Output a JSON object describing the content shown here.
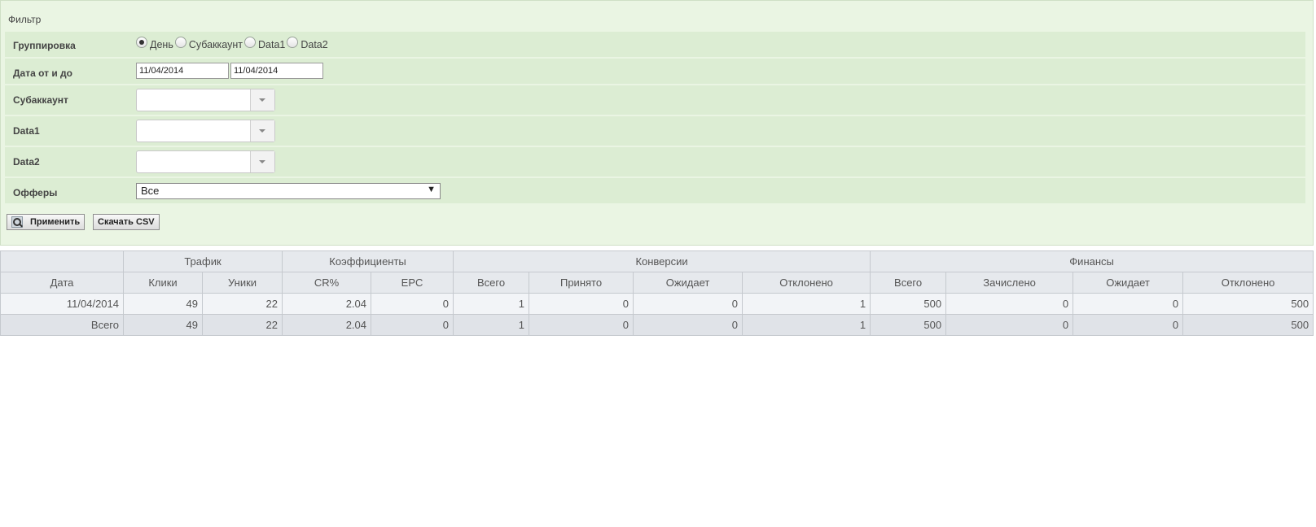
{
  "filter": {
    "legend": "Фильтр",
    "grouping": {
      "label": "Группировка",
      "options": [
        {
          "label": "День",
          "checked": true
        },
        {
          "label": "Субаккаунт",
          "checked": false
        },
        {
          "label": "Data1",
          "checked": false
        },
        {
          "label": "Data2",
          "checked": false
        }
      ]
    },
    "date_range": {
      "label": "Дата от и до",
      "from": "11/04/2014",
      "to": "11/04/2014"
    },
    "subaccount": {
      "label": "Субаккаунт",
      "value": ""
    },
    "data1": {
      "label": "Data1",
      "value": ""
    },
    "data2": {
      "label": "Data2",
      "value": ""
    },
    "offers": {
      "label": "Офферы",
      "selected": "Все"
    },
    "apply_label": "Применить",
    "csv_label": "Скачать CSV"
  },
  "table": {
    "groups": [
      "Трафик",
      "Коэффициенты",
      "Конверсии",
      "Финансы"
    ],
    "columns": [
      "Дата",
      "Клики",
      "Уники",
      "CR%",
      "EPC",
      "Всего",
      "Принято",
      "Ожидает",
      "Отклонено",
      "Всего",
      "Зачислено",
      "Ожидает",
      "Отклонено"
    ],
    "rows": [
      [
        "11/04/2014",
        "49",
        "22",
        "2.04",
        "0",
        "1",
        "0",
        "0",
        "1",
        "500",
        "0",
        "0",
        "500"
      ]
    ],
    "total": [
      "Всего",
      "49",
      "22",
      "2.04",
      "0",
      "1",
      "0",
      "0",
      "1",
      "500",
      "0",
      "0",
      "500"
    ]
  },
  "colors": {
    "panel_bg": "#eaf5e3",
    "row_bg": "#dcedd3",
    "header_bg": "#e6e9ed"
  }
}
